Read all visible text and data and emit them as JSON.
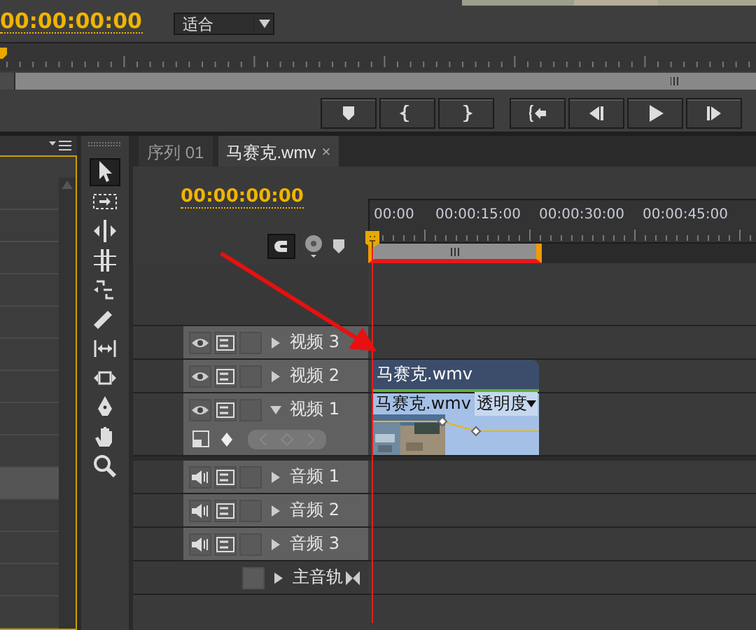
{
  "monitor": {
    "timecode": "00:00:00:00",
    "zoom": "适合"
  },
  "project": {
    "rows": [
      {
        "selected": false
      },
      {
        "selected": false
      },
      {
        "selected": false
      },
      {
        "selected": false
      },
      {
        "selected": false
      },
      {
        "selected": false
      },
      {
        "selected": false
      },
      {
        "selected": false
      },
      {
        "selected": false
      },
      {
        "selected": true
      },
      {
        "selected": false
      },
      {
        "selected": false
      },
      {
        "selected": false
      },
      {
        "selected": false
      }
    ]
  },
  "tools": [
    {
      "kind": "select",
      "selected": true
    },
    {
      "kind": "track",
      "selected": false
    },
    {
      "kind": "ripple",
      "selected": false
    },
    {
      "kind": "rolling",
      "selected": false
    },
    {
      "kind": "rate",
      "selected": false
    },
    {
      "kind": "razor",
      "selected": false
    },
    {
      "kind": "slip",
      "selected": false
    },
    {
      "kind": "slide",
      "selected": false
    },
    {
      "kind": "pen",
      "selected": false
    },
    {
      "kind": "hand",
      "selected": false
    },
    {
      "kind": "zoom",
      "selected": false
    }
  ],
  "timeline": {
    "tabs": [
      {
        "label": "序列 01",
        "selected": false
      },
      {
        "label": "马赛克.wmv",
        "selected": true,
        "close": "×"
      }
    ],
    "timecode": "00:00:00:00",
    "ruler_labels": [
      "00:00",
      "00:00:15:00",
      "00:00:30:00",
      "00:00:45:00"
    ],
    "tracks": [
      {
        "kind": "video",
        "name": "视频 3",
        "expanded": false
      },
      {
        "kind": "video",
        "name": "视频 2",
        "expanded": false,
        "clip": {
          "label": "马赛克.wmv"
        }
      },
      {
        "kind": "video",
        "name": "视频 1",
        "expanded": true,
        "clip": {
          "label": "马赛克.wmv",
          "property": "透明度"
        }
      },
      {
        "kind": "audio",
        "name": "音频 1",
        "expanded": false
      },
      {
        "kind": "audio",
        "name": "音频 2",
        "expanded": false
      },
      {
        "kind": "audio",
        "name": "音频 3",
        "expanded": false
      },
      {
        "kind": "master",
        "name": "主音轨",
        "expanded": false
      }
    ]
  }
}
